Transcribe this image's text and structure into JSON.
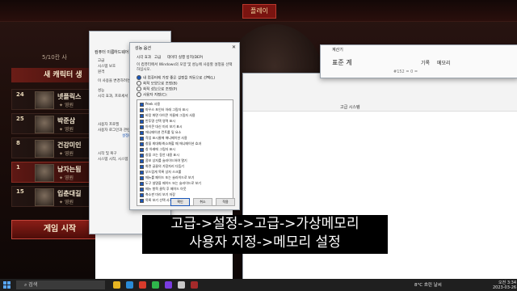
{
  "game": {
    "title": "플레이",
    "info": "5/10칸 사",
    "new_character": "새 캐릭터 생",
    "characters": [
      {
        "level": "24",
        "name": "넷플릭스",
        "class": "영원"
      },
      {
        "level": "25",
        "name": "박준삼",
        "class": "영원"
      },
      {
        "level": "8",
        "name": "건강미인",
        "class": "영원"
      },
      {
        "level": "1",
        "name": "남자는됨",
        "class": "영원"
      },
      {
        "level": "15",
        "name": "입춘대길",
        "class": "영원"
      }
    ],
    "start_button": "게임 시작"
  },
  "system_properties": {
    "tabs": [
      "컴퓨터 이름",
      "하드웨어"
    ],
    "lines": [
      "고급",
      "시스템 보호",
      "원격",
      "이 사용을 변경하려면",
      "성능",
      "시각 효과, 프로세서 일",
      "사용자 프로필",
      "사용자 로그인과 관련",
      "시작 및 복구",
      "시스템 시작, 시스템 실"
    ],
    "link": "설정(E)..."
  },
  "performance_options": {
    "title": "성능 옵션",
    "tabs": [
      "시각 효과",
      "고급",
      "데이터 실행 방지(DEP)"
    ],
    "intro": "이 컴퓨터에서 Windows의 모양 및 성능에 사용할 설정을 선택하십시오.",
    "radios": [
      "내 컴퓨터에 가장 좋은 설정을 자동으로 선택(L)",
      "최적 모양으로 조정(B)",
      "최적 성능으로 조정(P)",
      "사용자 지정(C):"
    ],
    "options": [
      "Peek 사용",
      "마우스 포인터 아래 그림자 표시",
      "바탕 화면 아이콘 이름에 그림자 사용",
      "반투명 선택 영역 표시",
      "아이콘 대신 미리 보기 표시",
      "애니메이션 컨트롤 및 요소",
      "작업 표시줄에 애니메이션 사용",
      "창을 최대화/최소화할 때 애니메이션 효과",
      "창 아래에 그림자 표시",
      "창을 끄는 동안 내용 표시",
      "콤보 상자를 슬라이드하여 열기",
      "화면 글꼴의 가장자리 다듬기",
      "부드럽게 목록 상자 스크롤",
      "메뉴를 페이드 또는 슬라이드로 보기",
      "도구 설명을 페이드 또는 슬라이드로 보기",
      "메뉴 항목 클릭 후 페이드 아웃",
      "축소판 미리 보기 저장",
      "목록 보기 선택 사각형 반투명"
    ],
    "buttons": [
      "확인",
      "취소",
      "적용"
    ]
  },
  "notepad": {
    "title": "계산기",
    "left_label": "표준 계",
    "tab1": "기록",
    "tab2": "메모리",
    "sub": "#152 = 0 ="
  },
  "explorer": {
    "path": "고급 시스템"
  },
  "subtitle": {
    "line1": "고급->설정->고급->가상메모리",
    "line2": "사용자 지정->메모리 설정"
  },
  "taskbar": {
    "search": "검색",
    "weather": "8°C 흐린 날씨",
    "time": "오전 3:34",
    "date": "2023-03-26"
  }
}
